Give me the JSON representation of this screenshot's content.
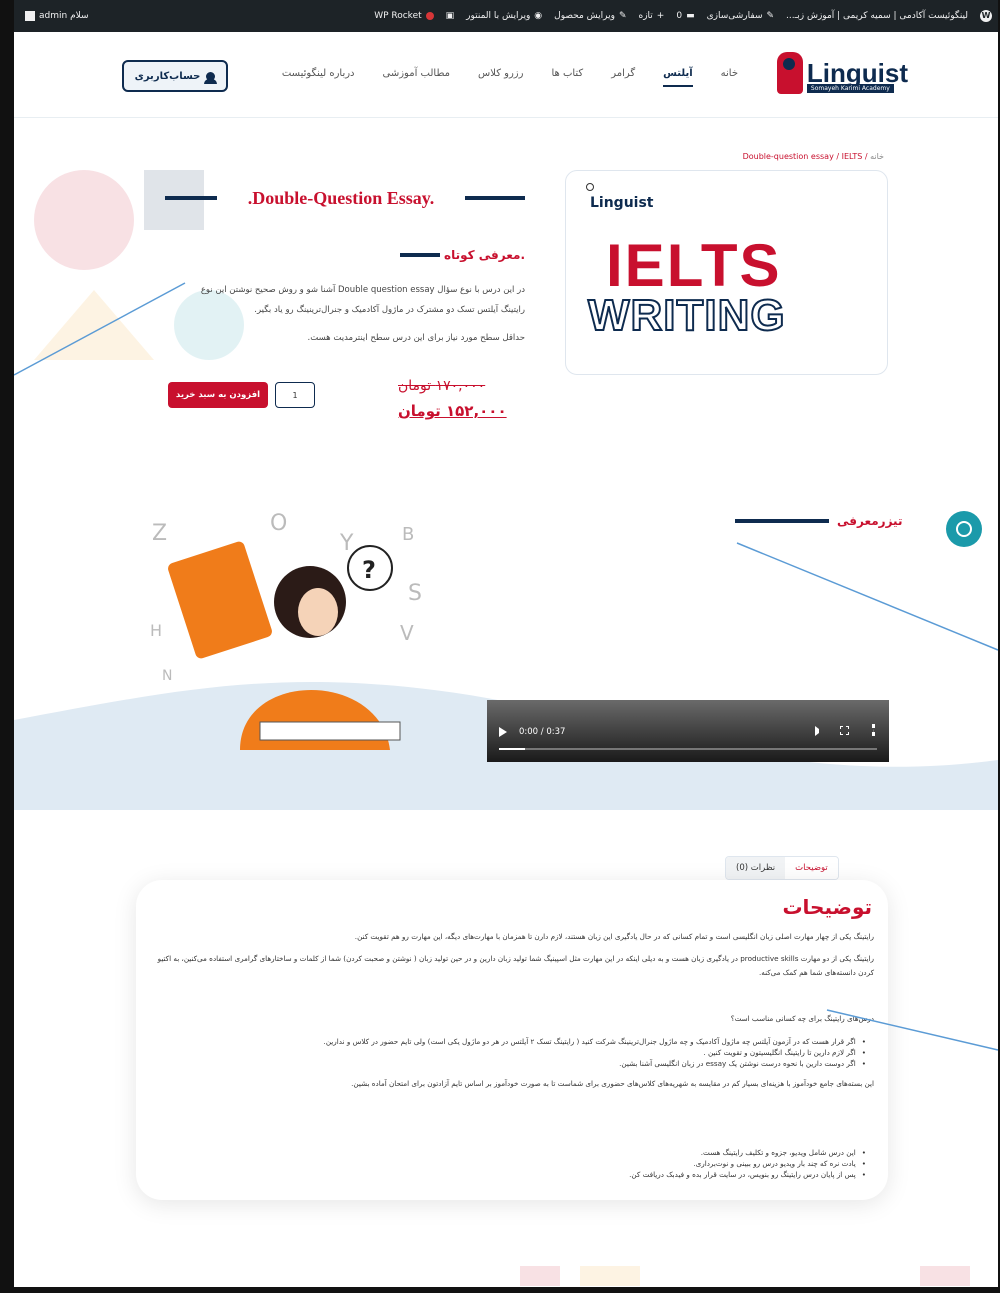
{
  "adminbar": {
    "site_name": "لینگوئیست آکادمی | سمیه کریمی | آموزش زبـ...",
    "customize": "سفارشی‌سازی",
    "comments": "0",
    "new": "تازه",
    "edit_product": "ویرایش محصول",
    "edit_elementor": "ویرایش با المنتور",
    "wp_rocket": "WP Rocket",
    "greeting": "سلام admin"
  },
  "header": {
    "logo_text": "Linguist",
    "logo_sub": "Somayeh Karimi Academy",
    "nav": [
      "خانه",
      "آیلتس",
      "گرامر",
      "کتاب ها",
      "رزرو کلاس",
      "مطالب آموزشی",
      "درباره لینگوئیست"
    ],
    "active_index": 1,
    "account_label": "حساب‌کاربری"
  },
  "product": {
    "breadcrumb_home": "خانه",
    "breadcrumb_sep": " / ",
    "breadcrumb_cat": "Double-question essay",
    "breadcrumb_cur": "IELTS",
    "image_logo": "Linguist",
    "image_line1": "IELTS",
    "image_line2": "WRITING",
    "title": ".Double-Question Essay.",
    "short_title": ".معرفی کوتاه",
    "desc1": "در این درس با نوع سؤال Double question essay آشنا شو و روش صحیح نوشتن این نوع رایتینگ آیلتس تسک دو مشترک در ماژول آکادمیک و جنرال‌ترینینگ رو یاد بگیر.",
    "desc2": "حداقل سطح مورد نیاز برای این درس سطح اینترمدیت هست.",
    "old_price": "۱۷۰,۰۰۰ تومان",
    "new_price": "۱۵۲,۰۰۰ تومان",
    "qty": "1",
    "add_to_cart": "افزودن به سبد خرید"
  },
  "teaser": {
    "title": "تیزرمعرفی",
    "video_time": "0:00 / 0:37",
    "progress": 0.07
  },
  "tabs": {
    "description": "توضیحات",
    "reviews": "نظرات (0)"
  },
  "description": {
    "heading": "توضیحات",
    "p1": "رایتینگ یکی از چهار مهارت اصلی زبان انگلیسی است و تمام کسانی که در حال یادگیری این زبان هستند، لازم دارن تا همزمان با مهارت‌های دیگه، این مهارت رو هم تقویت کنن.",
    "p2": "رایتینگ یکی از دو مهارت productive skills در یادگیری زبان هست و به دیلی اینکه در این مهارت مثل اسپینیگ شما تولید زبان دارین و در حین تولید زبان ( نوشتن و صحبت کردن) شما از کلمات و ساختارهای گرامری استفاده می‌کنین، به اکتیو کردن دانسته‌های شما هم کمک می‌کنه.",
    "q": "درس‌های رایتینگ برای چه کسانی مناسب است؟",
    "list1": [
      "اگر قرار هست که در آزمون آیلتس چه ماژول آکادمیک و چه ماژول جنرال‌ترینینگ شرکت کنید ( رایتینگ تسک ۲ آیلتس در هر دو ماژول یکی است) ولی تایم حضور در کلاس و ندارین.",
      "اگر لازم دارین تا رایتینگ انگلیسیتون و تقویت کنین .",
      "اگر دوست دارین با نحوه درست نوشتن یک essay در زبان انگلیسی آشنا بشین."
    ],
    "p3": "این بسته‌های جامع خودآموز با هزینه‌ای بسیار کم در مقایسه به شهریه‌های کلاس‌های حضوری برای شماست تا به صورت خودآموز بر اساس تایم آزادتون برای امتحان آماده بشین.",
    "list2": [
      "این درس شامل ویدیو، جزوه و تکلیف رایتینگ هست.",
      "یادت نره که چند بار ویدیو درس رو ببینی و نوت‌برداری.",
      "پس از پایان درس رایتینگ رو بنویس، در سایت قرار بده و فیدبک دریافت کن."
    ]
  },
  "colors": {
    "brand_red": "#c8102e",
    "brand_navy": "#0e2b4f",
    "annotation_blue": "#5b9bd5"
  }
}
